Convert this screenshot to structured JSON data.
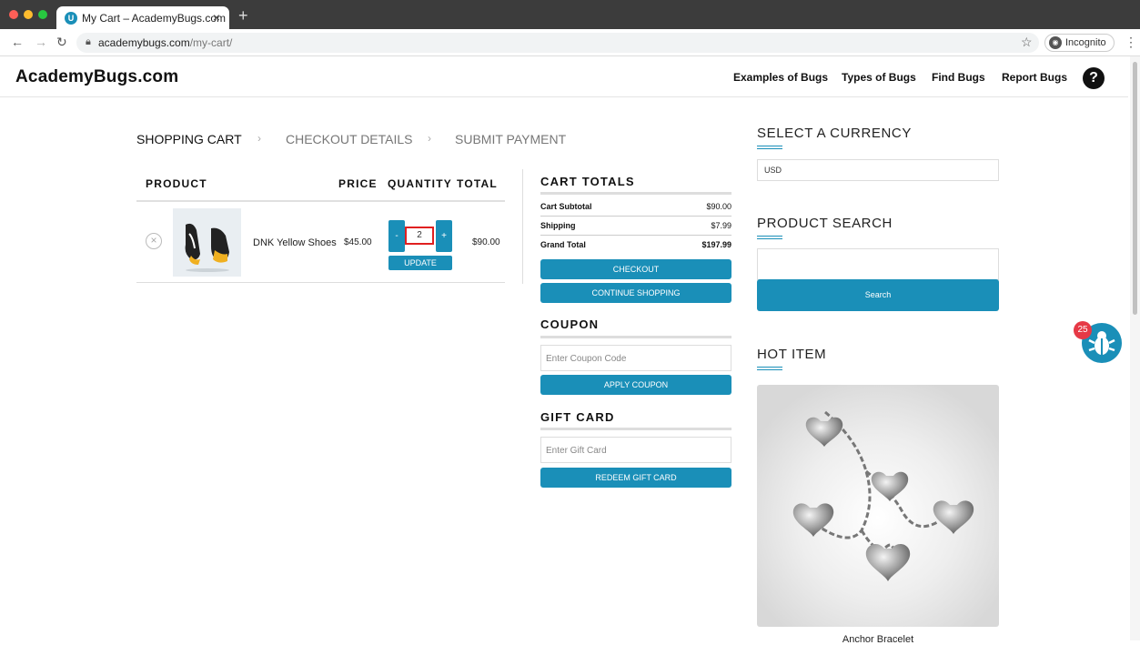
{
  "browser": {
    "tab_title": "My Cart – AcademyBugs.com",
    "tab_close": "×",
    "new_tab": "+",
    "url_host": "academybugs.com",
    "url_path": "/my-cart/",
    "incognito_label": "Incognito"
  },
  "site": {
    "logo": "AcademyBugs.com",
    "nav": [
      "Examples of Bugs",
      "Types of Bugs",
      "Find Bugs",
      "Report Bugs"
    ],
    "help": "?"
  },
  "steps": [
    "SHOPPING CART",
    "CHECKOUT DETAILS",
    "SUBMIT PAYMENT"
  ],
  "cart": {
    "headers": {
      "product": "PRODUCT",
      "price": "PRICE",
      "quantity": "QUANTITY",
      "total": "TOTAL"
    },
    "item": {
      "name": "DNK Yellow Shoes",
      "price": "$45.00",
      "quantity": "2",
      "total": "$90.00"
    },
    "minus": "-",
    "plus": "+",
    "update": "UPDATE"
  },
  "totals": {
    "title": "CART TOTALS",
    "subtotal_label": "Cart Subtotal",
    "subtotal": "$90.00",
    "shipping_label": "Shipping",
    "shipping": "$7.99",
    "grand_label": "Grand Total",
    "grand": "$197.99",
    "checkout": "CHECKOUT",
    "continue": "CONTINUE SHOPPING"
  },
  "coupon": {
    "title": "COUPON",
    "placeholder": "Enter Coupon Code",
    "apply": "APPLY COUPON"
  },
  "giftcard": {
    "title": "GIFT CARD",
    "placeholder": "Enter Gift Card",
    "redeem": "REDEEM GIFT CARD"
  },
  "sidebar": {
    "currency_title": "SELECT A CURRENCY",
    "currency_value": "USD",
    "search_title": "PRODUCT SEARCH",
    "search_button": "Search",
    "hot_title": "HOT ITEM",
    "hot_item_name": "Anchor Bracelet"
  },
  "bug_badge_count": "25",
  "colors": {
    "accent": "#1a8fb8",
    "highlight": "#e02020",
    "badge": "#e63946"
  }
}
